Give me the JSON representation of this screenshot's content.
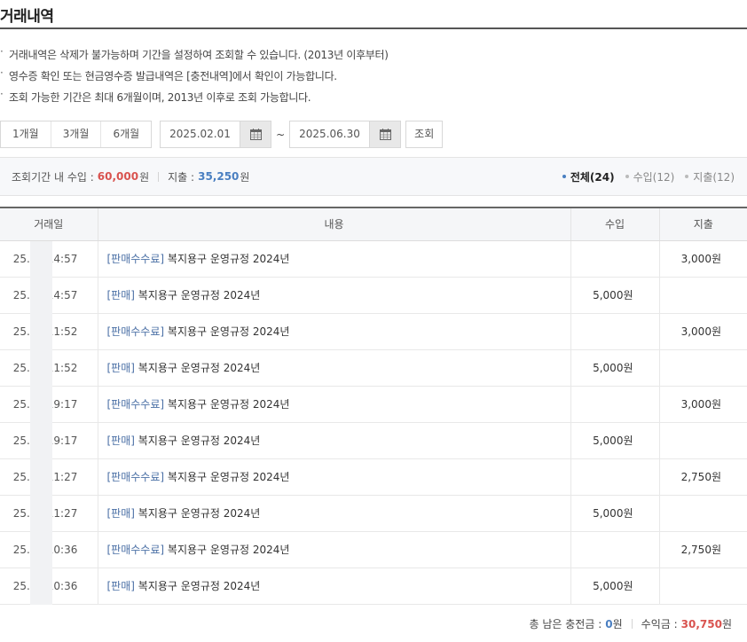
{
  "page": {
    "title": "거래내역"
  },
  "notices": [
    "거래내역은 삭제가 불가능하며 기간을 설정하여 조회할 수 있습니다. (2013년 이후부터)",
    "영수증 확인 또는 현금영수증 발급내역은 [충전내역]에서 확인이 가능합니다.",
    "조회 가능한 기간은 최대 6개월이며, 2013년 이후로 조회 가능합니다."
  ],
  "filter": {
    "periods": [
      "1개월",
      "3개월",
      "6개월"
    ],
    "start_date": "2025.02.01",
    "end_date": "2025.06.30",
    "tilde": "~",
    "search_label": "조회",
    "calendar_icon": "calendar-icon"
  },
  "summary": {
    "income_label": "조회기간 내 수입 :",
    "income_value": "60,000",
    "expense_label": "지출 :",
    "expense_value": "35,250",
    "unit": "원",
    "tabs": [
      {
        "label": "전체(24)",
        "active": true
      },
      {
        "label": "수입(12)",
        "active": false
      },
      {
        "label": "지출(12)",
        "active": false
      }
    ]
  },
  "table": {
    "headers": [
      "거래일",
      "내용",
      "수입",
      "지출"
    ],
    "rows": [
      {
        "date_prefix": "25.0",
        "time": "14:57",
        "tag": "[판매수수료]",
        "title": "복지용구 운영규정 2024년",
        "income": "",
        "expense": "3,000원"
      },
      {
        "date_prefix": "25.0",
        "time": "14:57",
        "tag": "[판매]",
        "title": "복지용구 운영규정 2024년",
        "income": "5,000원",
        "expense": ""
      },
      {
        "date_prefix": "25.0",
        "time": "11:52",
        "tag": "[판매수수료]",
        "title": "복지용구 운영규정 2024년",
        "income": "",
        "expense": "3,000원"
      },
      {
        "date_prefix": "25.0",
        "time": "11:52",
        "tag": "[판매]",
        "title": "복지용구 운영규정 2024년",
        "income": "5,000원",
        "expense": ""
      },
      {
        "date_prefix": "25.0",
        "time": "19:17",
        "tag": "[판매수수료]",
        "title": "복지용구 운영규정 2024년",
        "income": "",
        "expense": "3,000원"
      },
      {
        "date_prefix": "25.0",
        "time": "19:17",
        "tag": "[판매]",
        "title": "복지용구 운영규정 2024년",
        "income": "5,000원",
        "expense": ""
      },
      {
        "date_prefix": "25.0",
        "time": "11:27",
        "tag": "[판매수수료]",
        "title": "복지용구 운영규정 2024년",
        "income": "",
        "expense": "2,750원"
      },
      {
        "date_prefix": "25.0",
        "time": "11:27",
        "tag": "[판매]",
        "title": "복지용구 운영규정 2024년",
        "income": "5,000원",
        "expense": ""
      },
      {
        "date_prefix": "25.0",
        "time": "10:36",
        "tag": "[판매수수료]",
        "title": "복지용구 운영규정 2024년",
        "income": "",
        "expense": "2,750원"
      },
      {
        "date_prefix": "25.0",
        "time": "10:36",
        "tag": "[판매]",
        "title": "복지용구 운영규정 2024년",
        "income": "5,000원",
        "expense": ""
      }
    ]
  },
  "footer": {
    "remaining_label": "총 남은 충전금 :",
    "remaining_value": "0",
    "profit_label": "수익금 :",
    "profit_value": "30,750",
    "unit": "원"
  }
}
